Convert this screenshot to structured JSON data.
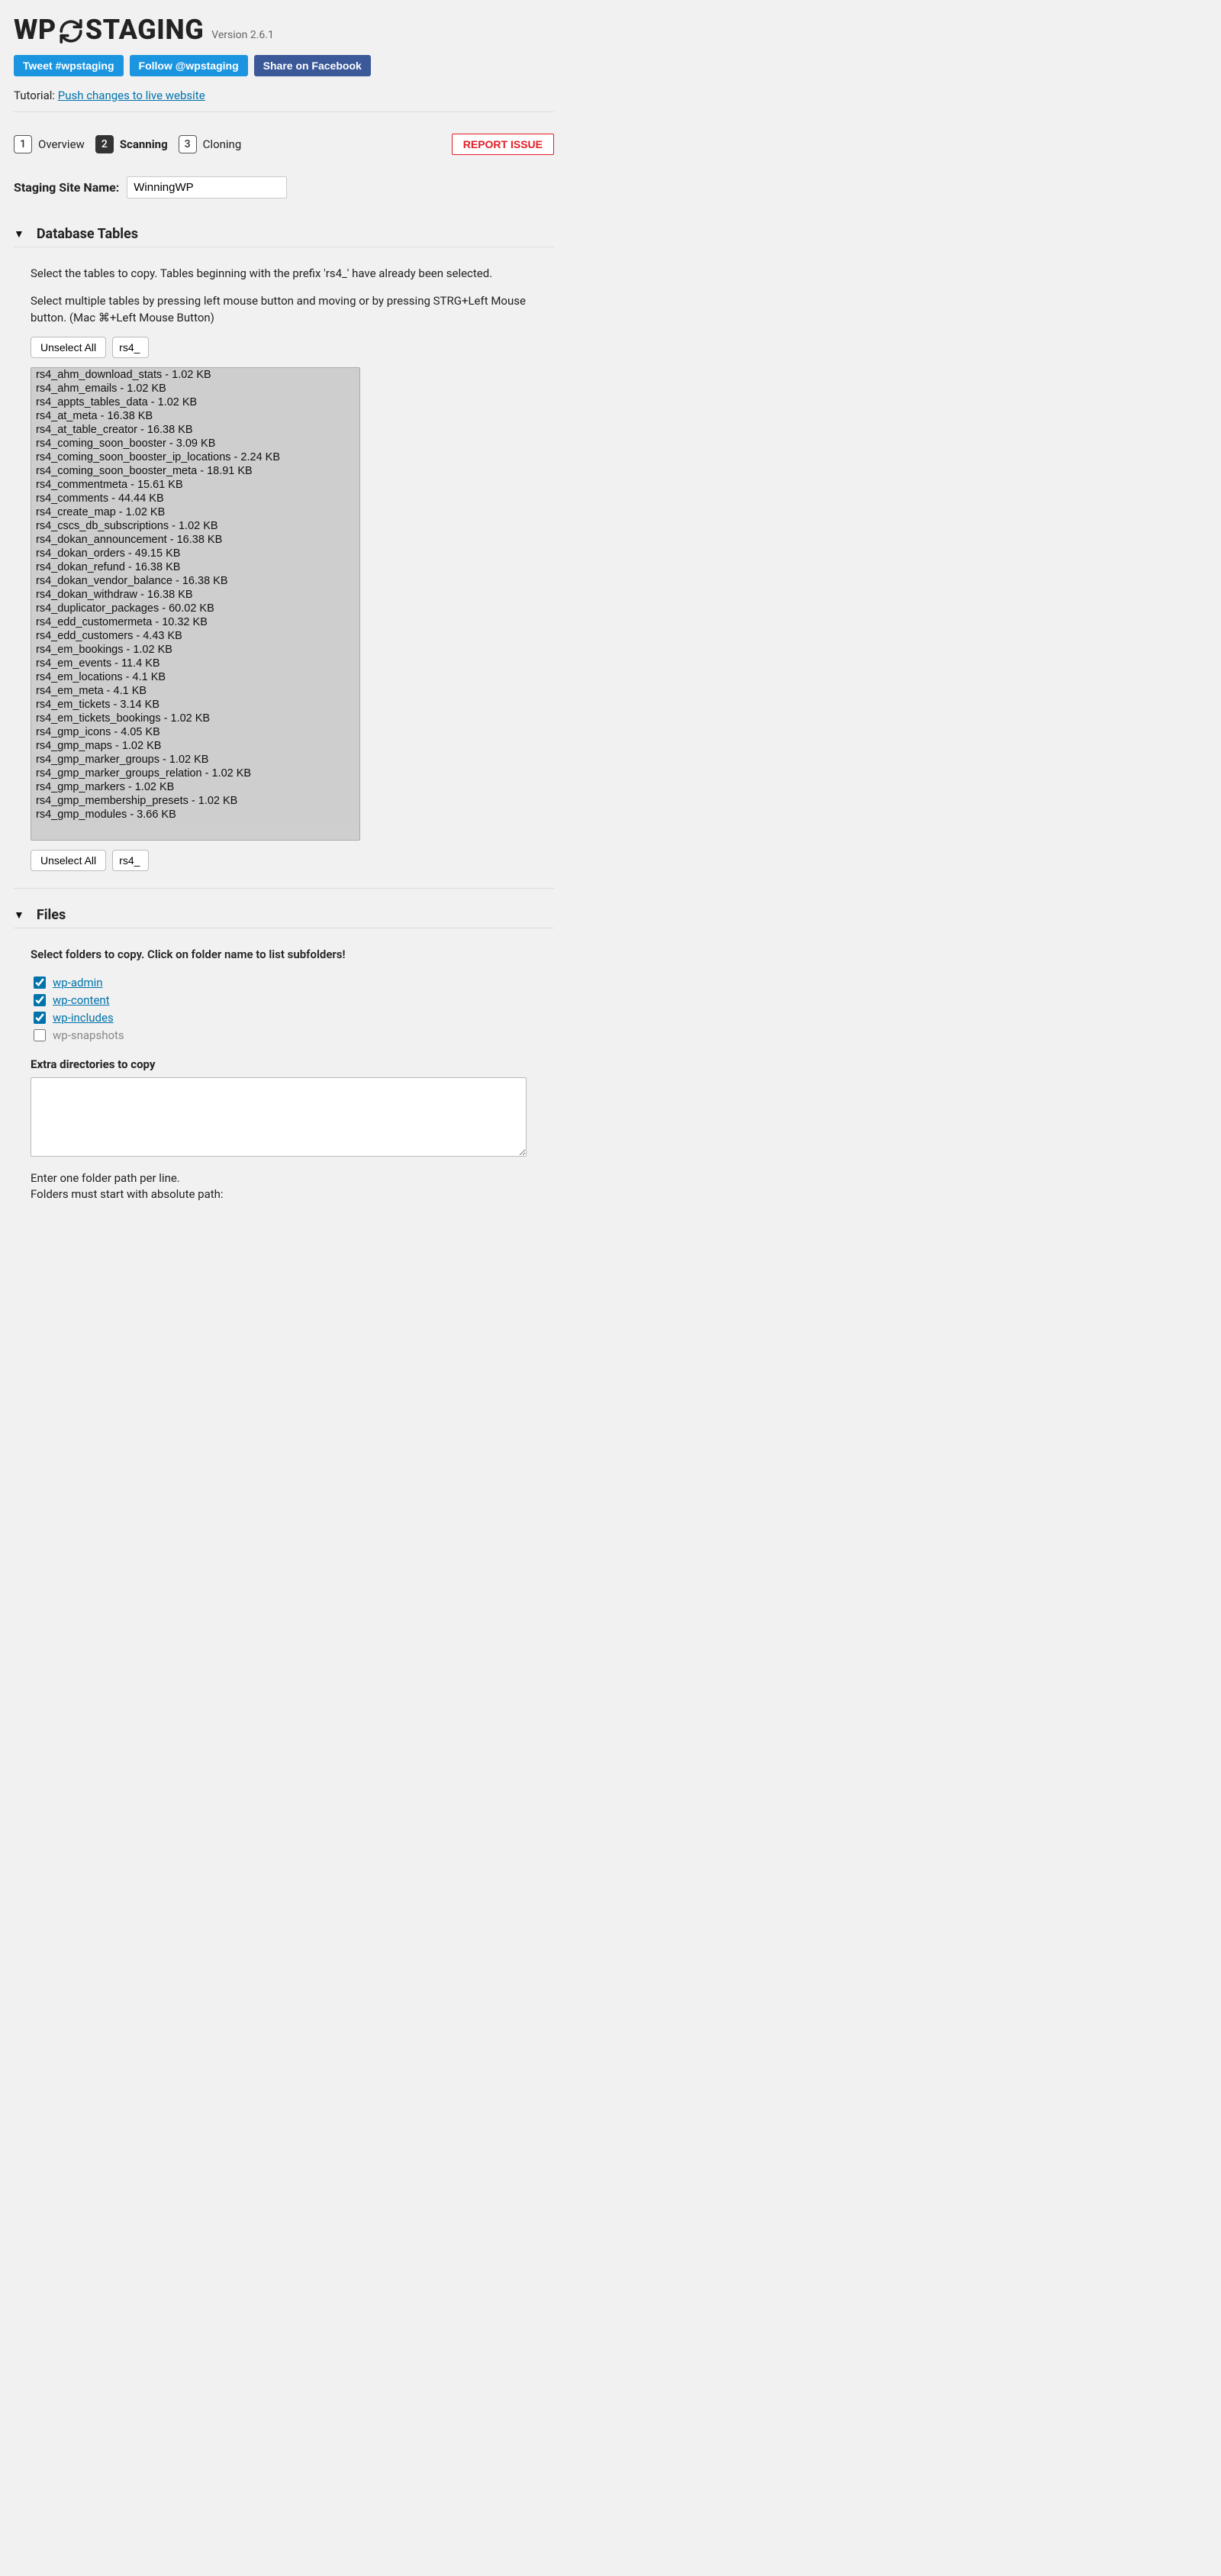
{
  "logo": {
    "part1": "WP",
    "part2": "STAGING"
  },
  "version": "Version 2.6.1",
  "share": {
    "tweet": "Tweet #wpstaging",
    "follow": "Follow @wpstaging",
    "facebook": "Share on Facebook"
  },
  "tutorial": {
    "prefix": "Tutorial: ",
    "link": "Push changes to live website"
  },
  "steps": [
    {
      "num": "1",
      "label": "Overview",
      "active": false
    },
    {
      "num": "2",
      "label": "Scanning",
      "active": true
    },
    {
      "num": "3",
      "label": "Cloning",
      "active": false
    }
  ],
  "report_issue": "REPORT ISSUE",
  "site_name": {
    "label": "Staging Site Name:",
    "value": "WinningWP"
  },
  "db_section": {
    "title": "Database Tables",
    "help1": "Select the tables to copy. Tables beginning with the prefix 'rs4_' have already been selected.",
    "help2": "Select multiple tables by pressing left mouse button and moving or by pressing STRG+Left Mouse button. (Mac ⌘+Left Mouse Button)",
    "unselect": "Unselect All",
    "prefix": "rs4_",
    "tables": [
      "rs4_ahm_download_stats - 1.02 KB",
      "rs4_ahm_emails - 1.02 KB",
      "rs4_appts_tables_data - 1.02 KB",
      "rs4_at_meta - 16.38 KB",
      "rs4_at_table_creator - 16.38 KB",
      "rs4_coming_soon_booster - 3.09 KB",
      "rs4_coming_soon_booster_ip_locations - 2.24 KB",
      "rs4_coming_soon_booster_meta - 18.91 KB",
      "rs4_commentmeta - 15.61 KB",
      "rs4_comments - 44.44 KB",
      "rs4_create_map - 1.02 KB",
      "rs4_cscs_db_subscriptions - 1.02 KB",
      "rs4_dokan_announcement - 16.38 KB",
      "rs4_dokan_orders - 49.15 KB",
      "rs4_dokan_refund - 16.38 KB",
      "rs4_dokan_vendor_balance - 16.38 KB",
      "rs4_dokan_withdraw - 16.38 KB",
      "rs4_duplicator_packages - 60.02 KB",
      "rs4_edd_customermeta - 10.32 KB",
      "rs4_edd_customers - 4.43 KB",
      "rs4_em_bookings - 1.02 KB",
      "rs4_em_events - 11.4 KB",
      "rs4_em_locations - 4.1 KB",
      "rs4_em_meta - 4.1 KB",
      "rs4_em_tickets - 3.14 KB",
      "rs4_em_tickets_bookings - 1.02 KB",
      "rs4_gmp_icons - 4.05 KB",
      "rs4_gmp_maps - 1.02 KB",
      "rs4_gmp_marker_groups - 1.02 KB",
      "rs4_gmp_marker_groups_relation - 1.02 KB",
      "rs4_gmp_markers - 1.02 KB",
      "rs4_gmp_membership_presets - 1.02 KB",
      "rs4_gmp_modules - 3.66 KB"
    ]
  },
  "files_section": {
    "title": "Files",
    "help": "Select folders to copy. Click on folder name to list subfolders!",
    "folders": [
      {
        "name": "wp-admin",
        "checked": true,
        "link": true
      },
      {
        "name": "wp-content",
        "checked": true,
        "link": true
      },
      {
        "name": "wp-includes",
        "checked": true,
        "link": true
      },
      {
        "name": "wp-snapshots",
        "checked": false,
        "link": false
      }
    ],
    "extra_label": "Extra directories to copy",
    "extra_value": "",
    "hint1": "Enter one folder path per line.",
    "hint2": "Folders must start with absolute path:"
  }
}
